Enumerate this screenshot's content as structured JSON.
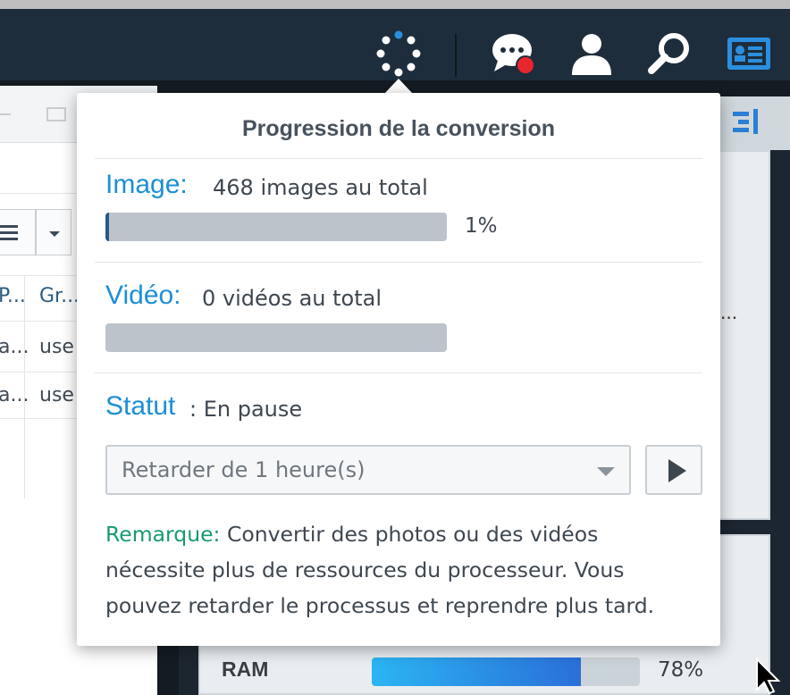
{
  "taskbar": {
    "icons": [
      "conversion-progress-icon",
      "chat-icon",
      "user-icon",
      "search-icon",
      "widgets-icon"
    ],
    "notification_color": "#e8262e",
    "accent": "#2b8fe0"
  },
  "left_window": {
    "columns": [
      "P...",
      "Gr..."
    ],
    "rows": [
      {
        "c1": "a...",
        "c2": "use"
      },
      {
        "c1": "a...",
        "c2": "use"
      }
    ]
  },
  "right_panel": {
    "ellipsis": "...",
    "ram_label": "RAM",
    "ram_value": 0.78,
    "ram_pct_text": "78%"
  },
  "popup": {
    "title": "Progression de la conversion",
    "image": {
      "label": "Image:",
      "value": "468 images au total",
      "progress": 0.01,
      "pct_text": "1%"
    },
    "video": {
      "label": "Vidéo:",
      "value": "0 vidéos au total",
      "progress": 0
    },
    "status": {
      "label": "Statut",
      "value": ": En pause"
    },
    "delay_select": {
      "value": "Retarder de 1 heure(s)"
    },
    "note": {
      "label": "Remarque:",
      "text": " Convertir des photos ou des vidéos nécessite plus de ressources du processeur. Vous pouvez retarder le processus et reprendre plus tard."
    },
    "colors": {
      "label_blue": "#1b8fd6",
      "note_green": "#179a6e",
      "bar_fill": "#2a5785"
    }
  }
}
